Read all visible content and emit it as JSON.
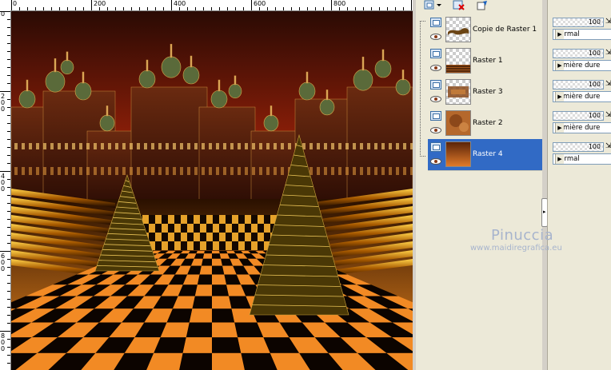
{
  "rulers": {
    "top_labels": [
      "0",
      "200",
      "400",
      "600",
      "800"
    ],
    "left_labels": [
      "0",
      "200",
      "400",
      "600",
      "800"
    ]
  },
  "canvas": {
    "description_icon": "image-canvas"
  },
  "layer_toolbar": {
    "icons": [
      "new-layer-icon",
      "delete-layer-icon",
      "edit-layer-icon"
    ]
  },
  "layers": [
    {
      "name": "Copie de Raster 1",
      "opacity": "100",
      "mode": "Normal",
      "selected": false
    },
    {
      "name": "Raster 1",
      "opacity": "100",
      "mode": "Lumière dure",
      "selected": false
    },
    {
      "name": "Raster 3",
      "opacity": "100",
      "mode": "Lumière dure",
      "selected": false
    },
    {
      "name": "Raster 2",
      "opacity": "100",
      "mode": "Lumière dure",
      "selected": false
    },
    {
      "name": "Raster 4",
      "opacity": "100",
      "mode": "Normal",
      "selected": true
    }
  ],
  "watermark": {
    "name": "Pinuccia",
    "url": "www.maidiregrafica.eu"
  },
  "colors": {
    "selection": "#316ac5",
    "panel": "#ece9d8",
    "watermark": "#a7b4cd"
  }
}
